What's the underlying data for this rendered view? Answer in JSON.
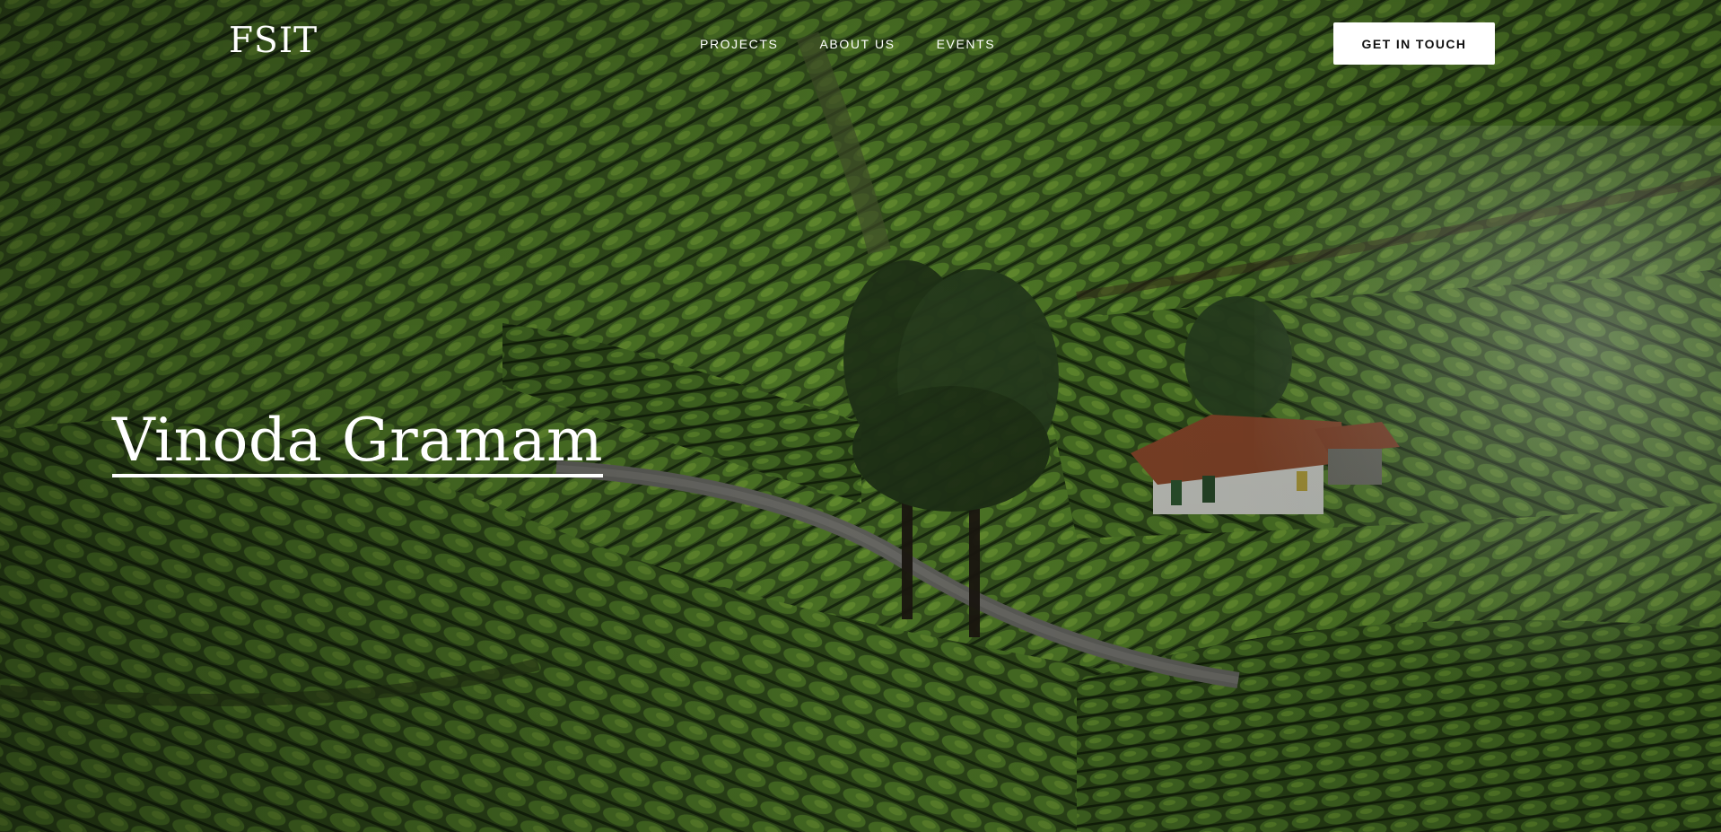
{
  "header": {
    "logo": "FSIT",
    "nav": [
      {
        "label": "PROJECTS"
      },
      {
        "label": "ABOUT US"
      },
      {
        "label": "EVENTS"
      }
    ],
    "cta_label": "GET IN TOUCH"
  },
  "hero": {
    "title": "Vinoda Gramam",
    "background": "tea-plantation-photo"
  },
  "colors": {
    "text": "#ffffff",
    "cta_background": "#ffffff",
    "cta_text": "#111111"
  }
}
